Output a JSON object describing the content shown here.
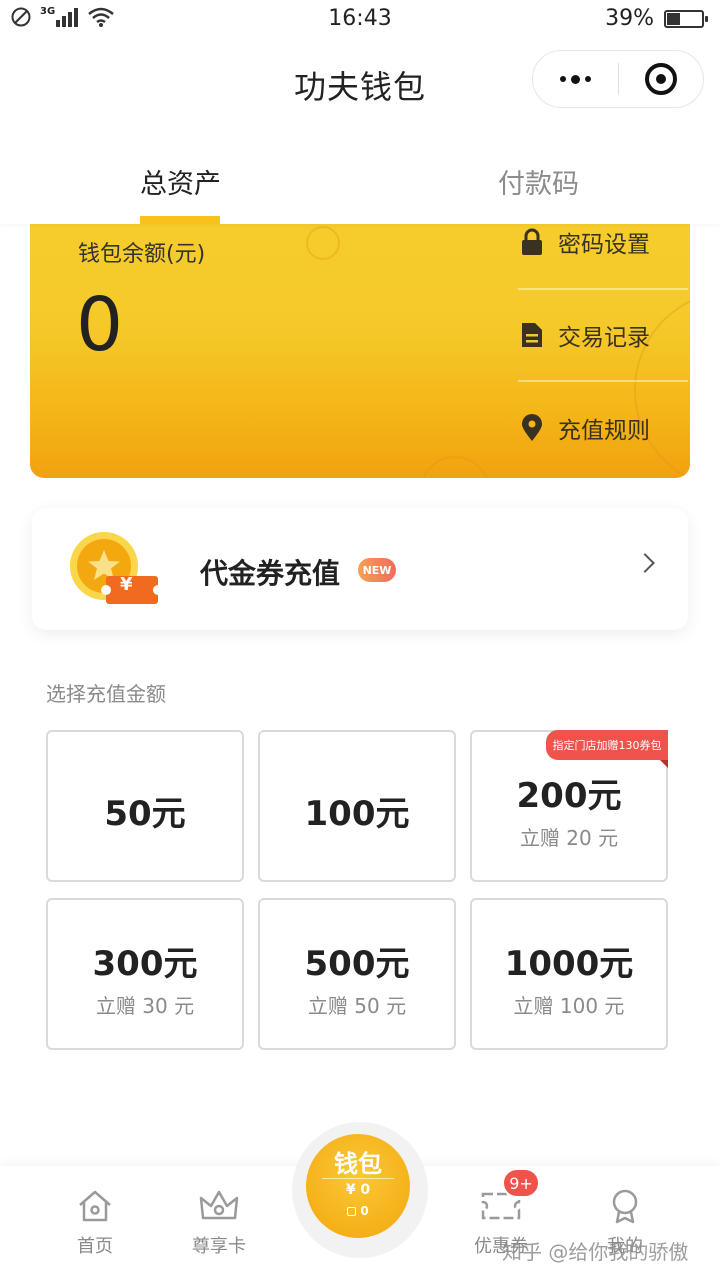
{
  "status_bar": {
    "network": "3G",
    "time": "16:43",
    "battery": "39%",
    "battery_level": 0.39
  },
  "header": {
    "title": "功夫钱包",
    "more_icon": "more-dots-icon",
    "close_icon": "target-close-icon"
  },
  "tabs": [
    {
      "label": "总资产",
      "active": true
    },
    {
      "label": "付款码",
      "active": false
    }
  ],
  "card": {
    "balance_label": "钱包余额(元)",
    "balance_value": "0",
    "actions": [
      {
        "label": "密码设置",
        "icon": "lock-icon"
      },
      {
        "label": "交易记录",
        "icon": "document-icon"
      },
      {
        "label": "充值规则",
        "icon": "location-pin-icon"
      }
    ]
  },
  "voucher": {
    "title": "代金券充值",
    "badge": "NEW",
    "coin_symbol": "¥"
  },
  "recharge": {
    "section_label": "选择充值金额",
    "options": [
      {
        "amount": "50元",
        "bonus": ""
      },
      {
        "amount": "100元",
        "bonus": ""
      },
      {
        "amount": "200元",
        "bonus": "立赠 20 元",
        "tag": "指定门店加赠130券包"
      },
      {
        "amount": "300元",
        "bonus": "立赠 30 元"
      },
      {
        "amount": "500元",
        "bonus": "立赠 50 元"
      },
      {
        "amount": "1000元",
        "bonus": "立赠 100 元"
      }
    ]
  },
  "bottom_nav": {
    "items": [
      {
        "label": "首页",
        "icon": "home-icon"
      },
      {
        "label": "尊享卡",
        "icon": "crown-icon"
      },
      {
        "label": "优惠券",
        "icon": "coupon-icon",
        "badge": "9+"
      },
      {
        "label": "我的",
        "icon": "profile-medal-icon"
      }
    ],
    "wallet": {
      "title": "钱包",
      "money": "¥ 0",
      "coupons": "0"
    }
  },
  "watermark": "知乎 @给你我的骄傲",
  "colors": {
    "accent": "#f7c31b",
    "badge_red": "#f0524c",
    "card_bottom": "#f2a20f"
  }
}
